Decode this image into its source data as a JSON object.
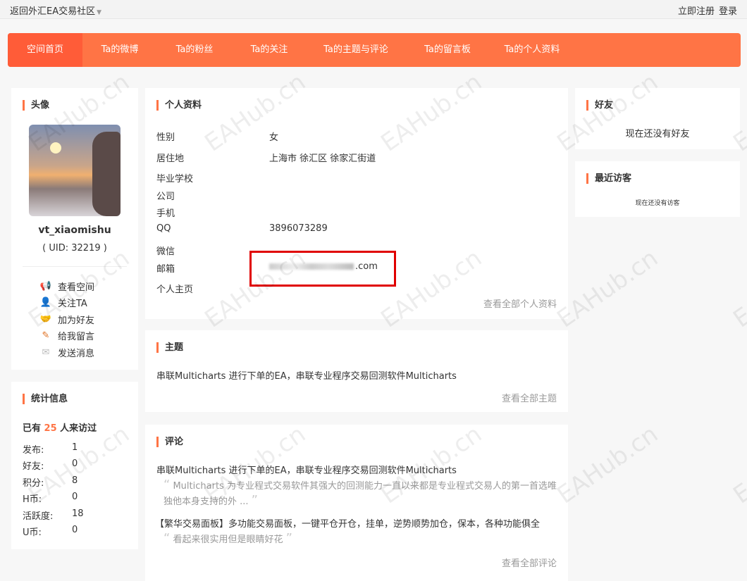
{
  "topbar": {
    "back": "返回外汇EA交易社区",
    "register": "立即注册",
    "login": "登录"
  },
  "nav": [
    "空间首页",
    "Ta的微博",
    "Ta的粉丝",
    "Ta的关注",
    "Ta的主题与评论",
    "Ta的留言板",
    "Ta的个人资料"
  ],
  "avatar_card": {
    "title": "头像",
    "username": "vt_xiaomishu",
    "uid": "( UID: 32219 )",
    "actions": [
      {
        "icon": "megaphone-icon",
        "label": "查看空间"
      },
      {
        "icon": "follow-user-icon",
        "label": "关注TA"
      },
      {
        "icon": "handshake-icon",
        "label": "加为好友"
      },
      {
        "icon": "pencil-icon",
        "label": "给我留言"
      },
      {
        "icon": "envelope-icon",
        "label": "发送消息"
      }
    ]
  },
  "stats": {
    "title": "统计信息",
    "visit_prefix": "已有",
    "visit_count": "25",
    "visit_suffix": "人来访过",
    "items": [
      {
        "label": "发布:",
        "value": "1"
      },
      {
        "label": "好友:",
        "value": "0"
      },
      {
        "label": "积分:",
        "value": "8"
      },
      {
        "label": "H币:",
        "value": "0"
      },
      {
        "label": "活跃度:",
        "value": "18"
      },
      {
        "label": "U币:",
        "value": "0"
      }
    ]
  },
  "profile": {
    "title": "个人资料",
    "rows": [
      {
        "label": "性别",
        "value": "女"
      },
      {
        "label": "居住地",
        "value": "上海市 徐汇区 徐家汇街道"
      },
      {
        "label": "毕业学校",
        "value": ""
      },
      {
        "label": "公司",
        "value": ""
      },
      {
        "label": "手机",
        "value": ""
      },
      {
        "label": "QQ",
        "value": "3896073289"
      },
      {
        "label": "微信",
        "value": ""
      },
      {
        "label": "邮箱",
        "value": ".com"
      },
      {
        "label": "个人主页",
        "value": ""
      }
    ],
    "more": "查看全部个人资料"
  },
  "topics": {
    "title": "主题",
    "items": [
      "串联Multicharts 进行下单的EA，串联专业程序交易回测软件Multicharts"
    ],
    "more": "查看全部主题"
  },
  "comments": {
    "title": "评论",
    "items": [
      {
        "title": "串联Multicharts 进行下单的EA，串联专业程序交易回测软件Multicharts",
        "quote": "Multicharts 为专业程式交易软件其强大的回测能力一直以来都是专业程式交易人的第一首选唯独他本身支持的外 ..."
      },
      {
        "title": "【繁华交易面板】多功能交易面板，一键平仓开仓，挂单，逆势顺势加仓，保本，各种功能俱全",
        "quote": "看起来很实用但是眼睛好花"
      }
    ],
    "more": "查看全部评论"
  },
  "friends": {
    "title": "好友",
    "empty": "现在还没有好友"
  },
  "visitors": {
    "title": "最近访客",
    "empty": "现在还没有访客"
  },
  "watermark": "EAHub.cn",
  "colors": {
    "accent": "#ff7445",
    "active_tab": "#ff5c38",
    "highlight_box": "#e00000"
  }
}
